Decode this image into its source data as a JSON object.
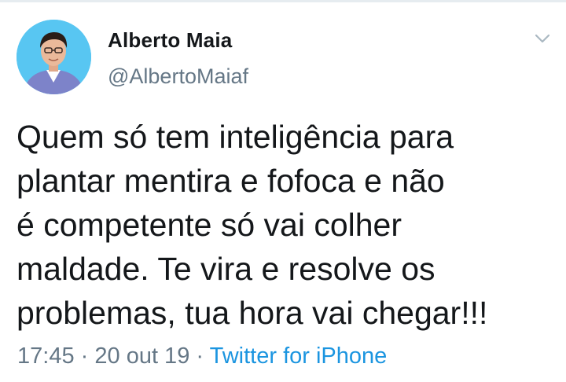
{
  "author": {
    "name": "Alberto Maia",
    "handle": "@AlbertoMaiaf",
    "avatar_icon": "profile-photo"
  },
  "menu": {
    "icon": "chevron-down-icon"
  },
  "tweet": {
    "lines": [
      "Quem só tem inteligência para",
      "plantar mentira e fofoca e não",
      "é competente só vai colher",
      "maldade. Te vira e resolve os",
      "problemas, tua hora vai chegar!!!"
    ]
  },
  "meta": {
    "time": "17:45",
    "separator": "·",
    "date": "20 out 19",
    "source": "Twitter for iPhone"
  },
  "colors": {
    "text": "#14171a",
    "secondary": "#657786",
    "link": "#1b95e0",
    "avatar_bg": "#58c6f2"
  }
}
